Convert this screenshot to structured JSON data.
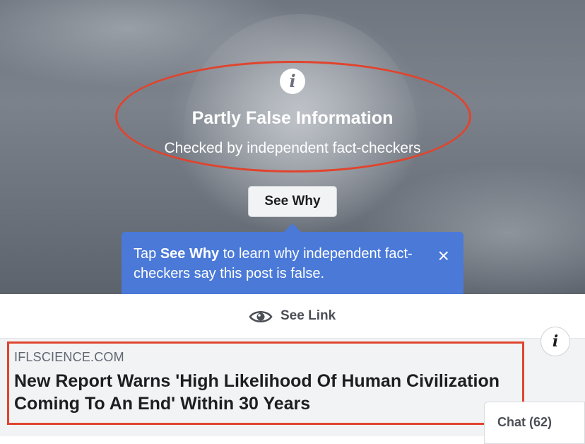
{
  "warning": {
    "title": "Partly False Information",
    "subtitle": "Checked by independent fact-checkers",
    "button_label": "See Why"
  },
  "tooltip": {
    "prefix": "Tap ",
    "bold": "See Why",
    "suffix": " to learn why independent fact-checkers say this post is false.",
    "close_glyph": "×"
  },
  "see_link": {
    "label": "See Link"
  },
  "link_card": {
    "domain": "IFLSCIENCE.COM",
    "headline": "New Report Warns 'High Likelihood Of Human Civilization Coming To An End' Within 30 Years"
  },
  "chat": {
    "label": "Chat (62)"
  },
  "icons": {
    "info": "info-icon",
    "eye": "eye-icon",
    "close": "close-icon"
  },
  "colors": {
    "tooltip_bg": "#4a79d8",
    "annotation_red": "#e0442e",
    "card_bg": "#f2f3f5"
  }
}
